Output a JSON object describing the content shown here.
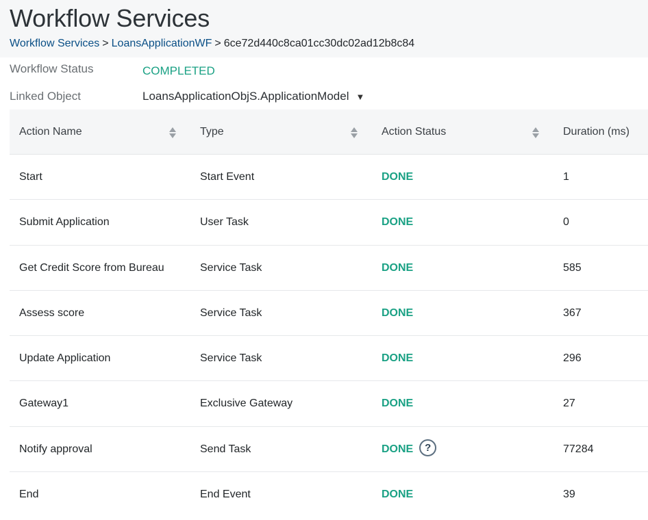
{
  "header": {
    "title": "Workflow Services",
    "breadcrumb": {
      "root": "Workflow Services",
      "workflow": "LoansApplicationWF",
      "sep": ">",
      "instance_id": "6ce72d440c8ca01cc30dc02ad12b8c84"
    }
  },
  "info": {
    "status_label": "Workflow Status",
    "status_value": "COMPLETED",
    "linked_label": "Linked Object",
    "linked_value": "LoansApplicationObjS.ApplicationModel"
  },
  "table": {
    "columns": [
      "Action Name",
      "Type",
      "Action Status",
      "Duration (ms)"
    ],
    "rows": [
      {
        "name": "Start",
        "type": "Start Event",
        "status": "DONE",
        "duration": "1"
      },
      {
        "name": "Submit Application",
        "type": "User Task",
        "status": "DONE",
        "duration": "0"
      },
      {
        "name": "Get Credit Score from Bureau",
        "type": "Service Task",
        "status": "DONE",
        "duration": "585"
      },
      {
        "name": "Assess score",
        "type": "Service Task",
        "status": "DONE",
        "duration": "367"
      },
      {
        "name": "Update Application",
        "type": "Service Task",
        "status": "DONE",
        "duration": "296"
      },
      {
        "name": "Gateway1",
        "type": "Exclusive Gateway",
        "status": "DONE",
        "duration": "27"
      },
      {
        "name": "Notify approval",
        "type": "Send Task",
        "status": "DONE",
        "duration": "77284",
        "help_icon": "question-circle-icon"
      },
      {
        "name": "End",
        "type": "End Event",
        "status": "DONE",
        "duration": "39"
      }
    ]
  },
  "colors": {
    "accent_green": "#1aa184",
    "link_blue": "#0a4f86",
    "header_bg": "#f6f7f8"
  }
}
